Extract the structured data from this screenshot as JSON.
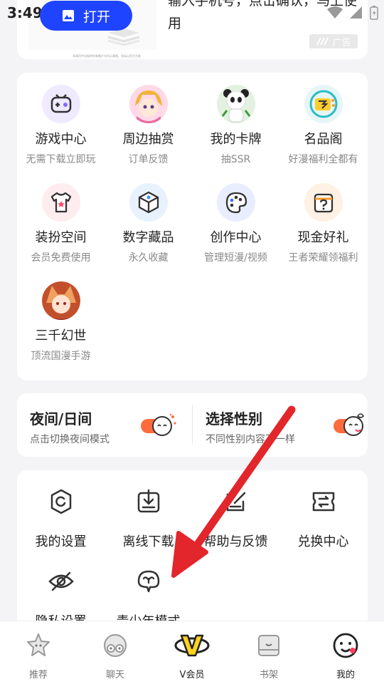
{
  "status": {
    "time": "3:49"
  },
  "ad": {
    "open_label": "打开",
    "text": "输入手机号，点击确认，马上使用",
    "badge": "广告",
    "tiny_text": "本网页中出现的所有图片均为示意图，实际以官方为准"
  },
  "services": [
    {
      "title": "游戏中心",
      "sub": "无需下载立即玩",
      "icon": "gamepad-icon",
      "bg": "#efeaff"
    },
    {
      "title": "周边抽赏",
      "sub": "订单反馈",
      "icon": "anime-girl-avatar",
      "bg": "#ffe6ef"
    },
    {
      "title": "我的卡牌",
      "sub": "抽SSR",
      "icon": "panda-avatar",
      "bg": "#e8f5e6"
    },
    {
      "title": "名品阁",
      "sub": "好漫福利全都有",
      "icon": "ming-badge-icon",
      "bg": "#e6f6f8"
    },
    {
      "title": "装扮空间",
      "sub": "会员免费使用",
      "icon": "tshirt-icon",
      "bg": "#ffecef"
    },
    {
      "title": "数字藏品",
      "sub": "永久收藏",
      "icon": "cube-icon",
      "bg": "#e8f2ff"
    },
    {
      "title": "创作中心",
      "sub": "管理短漫/视频",
      "icon": "palette-icon",
      "bg": "#e8eeff"
    },
    {
      "title": "现金好礼",
      "sub": "王者荣耀领福利",
      "icon": "gift-box-icon",
      "bg": "#fff1e4"
    },
    {
      "title": "三千幻世",
      "sub": "顶流国漫手游",
      "icon": "fox-girl-avatar",
      "bg": "#ffe8dc"
    }
  ],
  "toggles": [
    {
      "title": "夜间/日间",
      "sub": "点击切换夜间模式"
    },
    {
      "title": "选择性别",
      "sub": "不同性别内容不一样"
    }
  ],
  "settings": [
    {
      "label": "我的设置",
      "icon": "settings-gear-icon"
    },
    {
      "label": "离线下载",
      "icon": "download-icon"
    },
    {
      "label": "帮助与反馈",
      "icon": "feedback-edit-icon"
    },
    {
      "label": "兑换中心",
      "icon": "exchange-ticket-icon"
    },
    {
      "label": "隐私设置",
      "icon": "eye-off-icon"
    },
    {
      "label": "青少年模式",
      "icon": "sprout-umbrella-icon"
    }
  ],
  "nav": [
    {
      "label": "推荐",
      "icon": "star-icon"
    },
    {
      "label": "聊天",
      "icon": "chat-face-icon"
    },
    {
      "label": "V会员",
      "icon": "v-vip-icon"
    },
    {
      "label": "书架",
      "icon": "bookshelf-icon"
    },
    {
      "label": "我的",
      "icon": "smile-face-icon"
    }
  ],
  "colors": {
    "accent_blue": "#1f44ff",
    "toggle_orange": "#ff6b3d",
    "arrow_red": "#e2262b"
  }
}
